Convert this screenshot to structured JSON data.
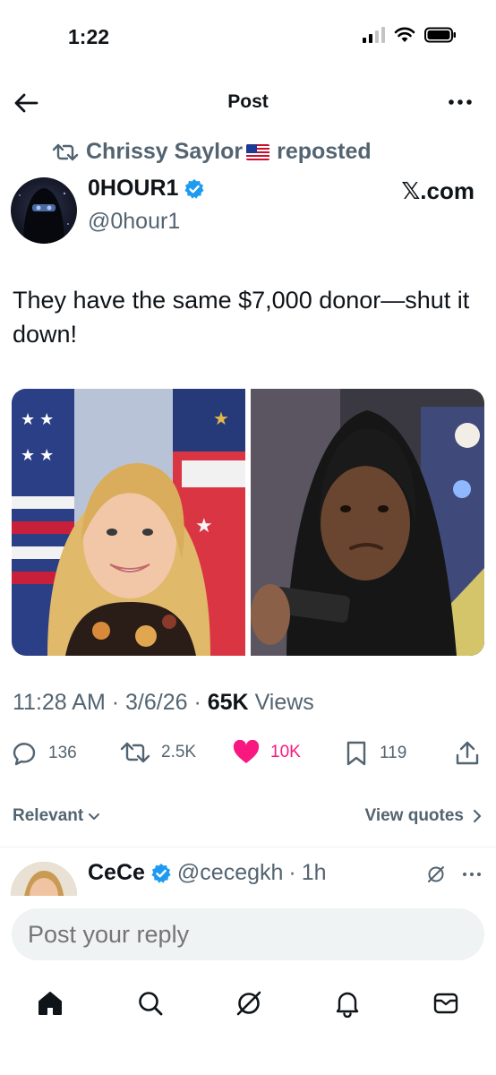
{
  "status_bar": {
    "time": "1:22"
  },
  "header": {
    "title": "Post"
  },
  "repost": {
    "name": "Chrissy Saylor",
    "suffix": "reposted"
  },
  "author": {
    "name": "0HOUR1",
    "handle": "@0hour1",
    "badge": "verified"
  },
  "source_label": "𝕏.com",
  "tweet": {
    "text": "They have the same $7,000 donor—shut it down!"
  },
  "meta": {
    "time": "11:28 AM",
    "date": "3/6/26",
    "views_count": "65K",
    "views_label": "Views"
  },
  "actions": {
    "replies": "136",
    "reposts": "2.5K",
    "likes": "10K",
    "bookmarks": "119"
  },
  "sort": {
    "relevant": "Relevant",
    "view_quotes": "View quotes"
  },
  "reply": {
    "name": "CeCe",
    "handle": "@cecegkh",
    "time": "1h"
  },
  "composer": {
    "placeholder": "Post your reply"
  },
  "tabbar": {
    "items": [
      "home-icon",
      "search-icon",
      "grok-icon",
      "notifications-icon",
      "messages-icon"
    ]
  },
  "colors": {
    "accent": "#1d9bf0",
    "like": "#f91880",
    "muted": "#536471",
    "text": "#0f1419"
  }
}
